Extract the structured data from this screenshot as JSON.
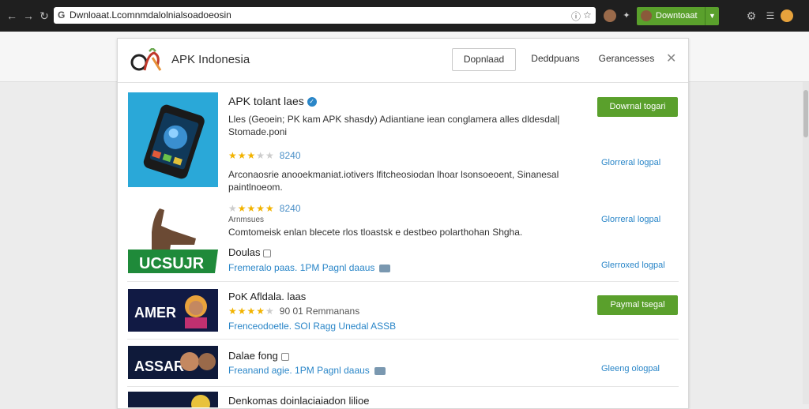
{
  "browser": {
    "url": "Dwnloaat.Lcomnmdalolnialsoadoeosin",
    "download_label": "Downtoaat"
  },
  "header": {
    "site_name": "APK Indonesia",
    "nav": [
      "Dopnlaad",
      "Deddpuans",
      "Gerancesses"
    ]
  },
  "apps": [
    {
      "title": "APK tolant laes",
      "description": "Lles (Geoein; PK kam APK shasdy) Adiantiane iean conglamera alles dldesdal| Stomade.poni",
      "stars": 3.5,
      "rating_text": "8240",
      "button_label": "Dowrnal togari",
      "link_label": "Glorreral logpal"
    },
    {
      "description": "Arconaosrie anooekmaniat.iotivers  lfitcheosiodan lhoar lsonsoeoent, Sinanesal paintlnoeom.",
      "link_label": "Glorreral logpal"
    },
    {
      "stars": 4.0,
      "rating_text": "8240",
      "subtext": "Arnmsues",
      "description": "Comtomeisk enlan blecete rlos tloastsk e destbeo polarthohan Shgha.",
      "link_label": "Gloerreral logpal"
    },
    {
      "title": "Doulas",
      "meta": "Fremeralo paas.  1PM Pagnl daaus",
      "link_label": "Glerroxed logpal",
      "thumb_text": "UCSUJR"
    },
    {
      "title": "PoK Afldala. laas",
      "stars": 4.0,
      "rating_text": "90 01 Remmanans",
      "meta": "Frenceodoetle.  SOI Ragg  Unedal  ASSB",
      "button_label": "Paymal tsegal",
      "thumb_text": "AMER"
    },
    {
      "title": "Dalae fong",
      "meta": "Freanand agie.  1PM Pagnl daaus",
      "link_label": "Gleeng ologpal",
      "thumb_text": "ASSAR"
    },
    {
      "title": "Denkomas doinlaciaiadon lilioe"
    }
  ]
}
